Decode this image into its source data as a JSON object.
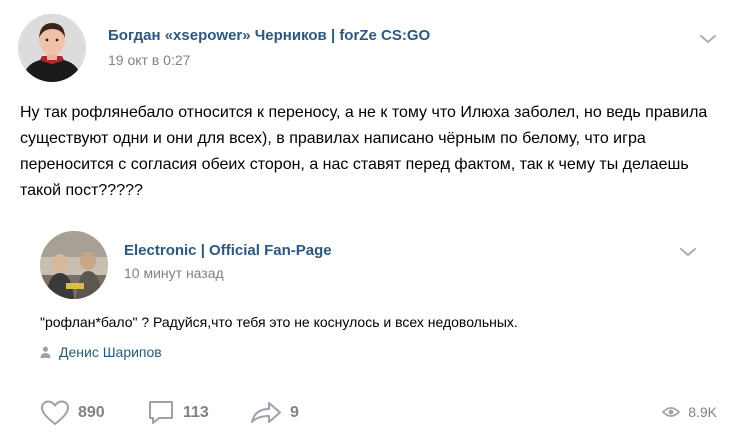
{
  "post": {
    "author": "Богдан «xsepower» Черников | forZe CS:GO",
    "date": "19 окт в 0:27",
    "text": "Ну так рофлянебало относится к переносу, а не к тому что Илюха заболел, но ведь правила существуют одни и они для всех), в правилах написано чёрным по белому, что игра переносится с согласия обеих сторон, а нас ставят перед фактом, так к чему ты делаешь такой пост?????"
  },
  "repost": {
    "author": "Electronic | Official Fan-Page",
    "date": "10 минут назад",
    "text": "\"рофлан*бало\" ? Радуйся,что тебя это не коснулось и всех недовольных.",
    "signer": "Денис Шарипов"
  },
  "actions": {
    "likes": "890",
    "comments": "113",
    "shares": "9",
    "views": "8.9K"
  },
  "colors": {
    "link": "#2a5885",
    "muted": "#828282",
    "icon": "#99a2ad"
  }
}
